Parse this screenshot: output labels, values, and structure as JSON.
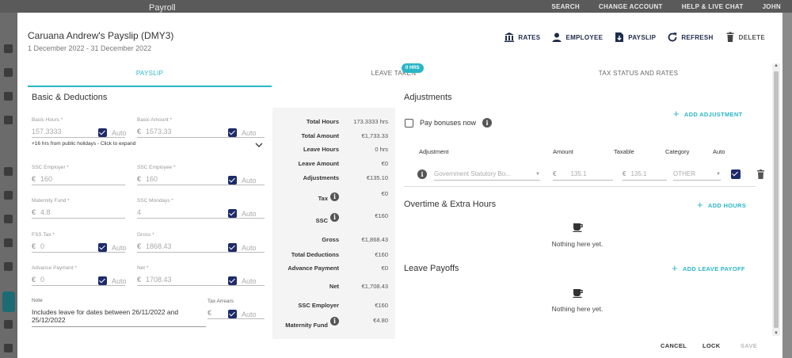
{
  "background": {
    "app_title": "Payroll",
    "top_actions": [
      "SEARCH",
      "CHANGE ACCOUNT",
      "HELP & LIVE CHAT",
      "JOHN"
    ]
  },
  "dialog": {
    "title": "Caruana Andrew's Payslip (DMY3)",
    "period": "1 December 2022 - 31 December 2022",
    "actions": [
      {
        "label": "RATES",
        "icon": "bank-icon"
      },
      {
        "label": "EMPLOYEE",
        "icon": "person-icon"
      },
      {
        "label": "PAYSLIP",
        "icon": "payslip-download-icon"
      },
      {
        "label": "REFRESH",
        "icon": "refresh-icon"
      },
      {
        "label": "DELETE",
        "icon": "trash-icon"
      }
    ],
    "tabs": [
      {
        "label": "PAYSLIP",
        "active": true
      },
      {
        "label": "LEAVE TAKEN",
        "badge": "0 HRS"
      },
      {
        "label": "TAX STATUS AND RATES"
      }
    ]
  },
  "basic": {
    "title": "Basic & Deductions",
    "auto_label": "Auto",
    "fields": {
      "basic_hours": {
        "label": "Basic Hours *",
        "value": "157.3333",
        "prefix": ""
      },
      "basic_amount": {
        "label": "Basic Amount *",
        "value": "1573.33",
        "prefix": "€"
      },
      "ssc_employer": {
        "label": "SSC Employer *",
        "value": "160",
        "prefix": "€"
      },
      "ssc_employee": {
        "label": "SSC Employee *",
        "value": "160",
        "prefix": "€"
      },
      "maternity_fund": {
        "label": "Maternity Fund *",
        "value": "4.8",
        "prefix": "€"
      },
      "ssc_mondays": {
        "label": "SSC Mondays *",
        "value": "4",
        "prefix": ""
      },
      "fss_tax": {
        "label": "FSS Tax *",
        "value": "0",
        "prefix": "€"
      },
      "gross": {
        "label": "Gross *",
        "value": "1868.43",
        "prefix": "€"
      },
      "advance_payment": {
        "label": "Advance Payment *",
        "value": "0",
        "prefix": "€"
      },
      "net": {
        "label": "Net *",
        "value": "1708.43",
        "prefix": "€"
      },
      "tax_arrears": {
        "label": "Tax Arrears",
        "value": "",
        "prefix": "€"
      }
    },
    "holiday_hint": "+16 hrs from public holidays - Click to expand",
    "note": {
      "label": "Note",
      "text": "Includes leave for dates between 26/11/2022 and 25/12/2022"
    }
  },
  "summary": [
    {
      "key": "Total Hours",
      "value": "173.3333 hrs"
    },
    {
      "key": "Total Amount",
      "value": "€1,733.33"
    },
    {
      "key": "Leave Hours",
      "value": "0 hrs"
    },
    {
      "key": "Leave Amount",
      "value": "€0"
    },
    {
      "key": "Adjustments",
      "value": "€135.10"
    },
    {
      "key": "Tax",
      "value": "€0",
      "info": true
    },
    {
      "key": "SSC",
      "value": "€160",
      "info": true
    },
    {
      "key": "Gross",
      "value": "€1,868.43"
    },
    {
      "key": "Total Deductions",
      "value": "€160"
    },
    {
      "key": "Advance Payment",
      "value": "€0"
    },
    {
      "key": "Net",
      "value": "€1,708.43"
    },
    {
      "key": "SSC Employer",
      "value": "€160"
    },
    {
      "key": "Maternity Fund",
      "value": "€4.80",
      "info": true
    }
  ],
  "adjustments": {
    "title": "Adjustments",
    "add_label": "ADD ADJUSTMENT",
    "pay_bonuses_label": "Pay bonuses now",
    "columns": [
      "Adjustment",
      "Amount",
      "Taxable",
      "Category",
      "Auto"
    ],
    "rows": [
      {
        "adjustment": "Government Statutory Bo...",
        "amount_prefix": "€",
        "amount": "135.1",
        "taxable_prefix": "€",
        "taxable": "135.1",
        "category": "OTHER",
        "auto": true
      }
    ]
  },
  "overtime": {
    "title": "Overtime & Extra Hours",
    "add_label": "ADD HOURS",
    "empty": "Nothing here yet."
  },
  "leave_payoffs": {
    "title": "Leave Payoffs",
    "add_label": "ADD LEAVE PAYOFF",
    "empty": "Nothing here yet."
  },
  "footer": {
    "cancel": "CANCEL",
    "lock": "LOCK",
    "save": "SAVE"
  },
  "colors": {
    "accent": "#2bb6c7",
    "navy": "#1e2b6a"
  }
}
